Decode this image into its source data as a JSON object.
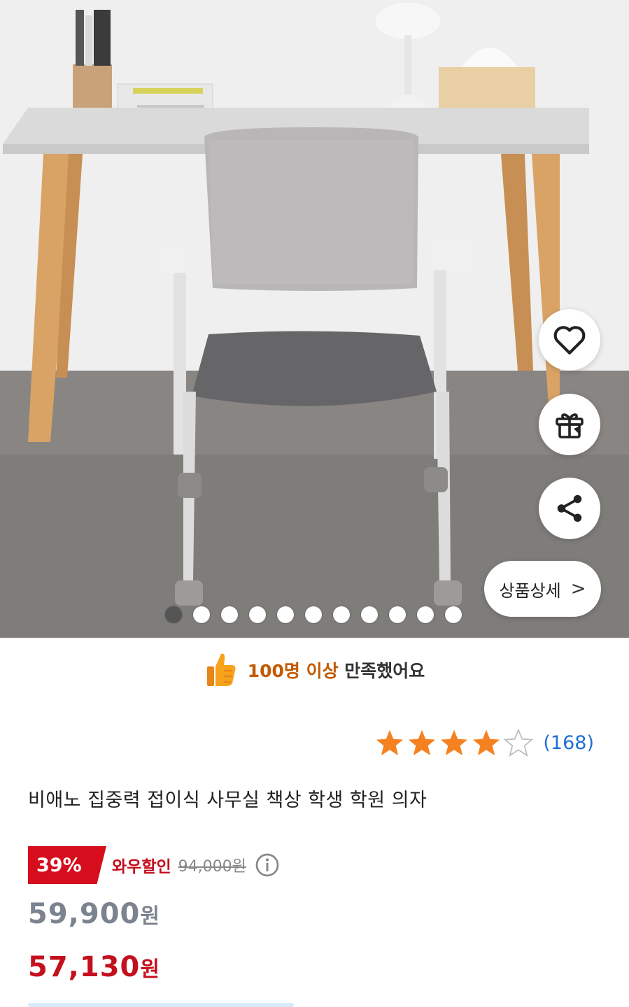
{
  "hero": {
    "image_subject": "chair-photo",
    "slide_count": 11,
    "active_slide": 1
  },
  "actions": {
    "wishlist_icon": "heart-icon",
    "gift_icon": "gift-icon",
    "share_icon": "share-icon",
    "detail_label": "상품상세",
    "detail_chevron": ">"
  },
  "satisfaction": {
    "icon": "thumbs-up-icon",
    "highlight": "100명 이상",
    "rest": "만족했어요"
  },
  "rating": {
    "stars_filled": 4,
    "stars_total": 5,
    "count": "(168)",
    "star_color": "#f58220"
  },
  "product": {
    "title": "비애노 집중력 접이식 사무실 책상 학생 학원 의자"
  },
  "pricing": {
    "discount_pct": "39%",
    "wow_label": "와우할인",
    "original_price": "94,000원",
    "list_price": "59,900",
    "list_unit": "원",
    "final_price": "57,130",
    "final_unit": "원",
    "accent_red": "#c4101e"
  }
}
